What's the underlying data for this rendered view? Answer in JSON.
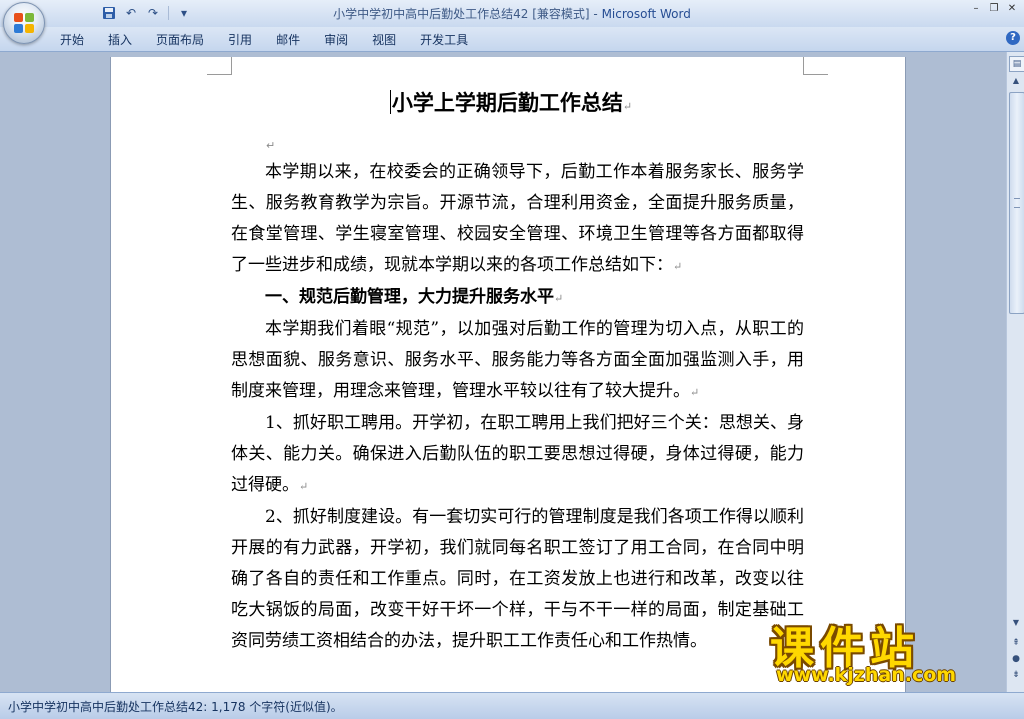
{
  "window": {
    "title_doc": "小学中学初中高中后勤处工作总结42 [兼容模式]",
    "title_sep": " - ",
    "title_app": "Microsoft Word",
    "minimize": "–",
    "restore": "❐",
    "close": "✕"
  },
  "qat": {
    "save": "save-icon",
    "undo": "↶",
    "redo": "↷",
    "customize": "▾"
  },
  "ribbon": {
    "tabs": [
      "开始",
      "插入",
      "页面布局",
      "引用",
      "邮件",
      "审阅",
      "视图",
      "开发工具"
    ],
    "help": "?"
  },
  "document": {
    "title": "小学上学期后勤工作总结",
    "mark": "↵",
    "paragraphs": [
      "本学期以来，在校委会的正确领导下，后勤工作本着服务家长、服务学生、服务教育教学为宗旨。开源节流，合理利用资金，全面提升服务质量，在食堂管理、学生寝室管理、校园安全管理、环境卫生管理等各方面都取得了一些进步和成绩，现就本学期以来的各项工作总结如下：",
      "一、规范后勤管理，大力提升服务水平",
      "本学期我们着眼“规范”，以加强对后勤工作的管理为切入点，从职工的思想面貌、服务意识、服务水平、服务能力等各方面全面加强监测入手，用制度来管理，用理念来管理，管理水平较以往有了较大提升。",
      "1、抓好职工聘用。开学初，在职工聘用上我们把好三个关：思想关、身体关、能力关。确保进入后勤队伍的职工要思想过得硬，身体过得硬，能力过得硬。",
      "2、抓好制度建设。有一套切实可行的管理制度是我们各项工作得以顺利开展的有力武器，开学初，我们就同每名职工签订了用工合同，在合同中明确了各自的责任和工作重点。同时，在工资发放上也进行和改革，改变以往吃大锅饭的局面，改变干好干坏一个样，干与不干一样的局面，制定基础工资同劳绩工资相结合的办法，提升职工工作责任心和工作热情。"
    ]
  },
  "statusbar": {
    "text": "小学中学初中高中后勤处工作总结42: 1,178 个字符(近似值)。"
  },
  "scrollbar": {
    "up": "▲",
    "down": "▼",
    "prev_page": "⇞",
    "browse": "●",
    "next_page": "⇟",
    "ruler": "▤"
  },
  "watermark": {
    "cn": "课件站",
    "url": "www.kjzhan.com"
  },
  "colors": {
    "accent": "#264d93",
    "workspace": "#aebdd3",
    "watermark": "#ffd800"
  }
}
